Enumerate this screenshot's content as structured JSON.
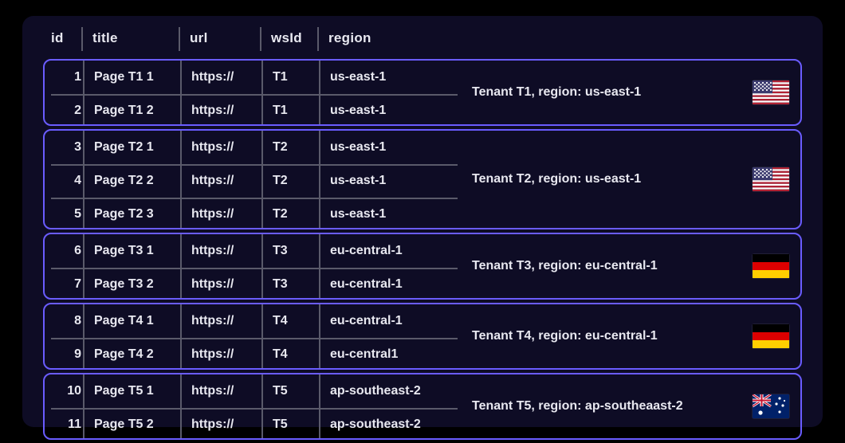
{
  "columns": {
    "id": "id",
    "title": "title",
    "url": "url",
    "wsid": "wsId",
    "region": "region"
  },
  "groups": [
    {
      "summary": "Tenant T1, region: us-east-1",
      "flag": "us",
      "rows": [
        {
          "id": "1",
          "title": "Page T1 1",
          "url": "https://",
          "wsid": "T1",
          "region": "us-east-1"
        },
        {
          "id": "2",
          "title": "Page T1 2",
          "url": "https://",
          "wsid": "T1",
          "region": "us-east-1"
        }
      ]
    },
    {
      "summary": "Tenant T2, region: us-east-1",
      "flag": "us",
      "rows": [
        {
          "id": "3",
          "title": "Page T2 1",
          "url": "https://",
          "wsid": "T2",
          "region": "us-east-1"
        },
        {
          "id": "4",
          "title": "Page T2 2",
          "url": "https://",
          "wsid": "T2",
          "region": "us-east-1"
        },
        {
          "id": "5",
          "title": "Page T2 3",
          "url": "https://",
          "wsid": "T2",
          "region": "us-east-1"
        }
      ]
    },
    {
      "summary": "Tenant T3, region: eu-central-1",
      "flag": "de",
      "rows": [
        {
          "id": "6",
          "title": "Page T3 1",
          "url": "https://",
          "wsid": "T3",
          "region": "eu-central-1"
        },
        {
          "id": "7",
          "title": "Page T3 2",
          "url": "https://",
          "wsid": "T3",
          "region": "eu-central-1"
        }
      ]
    },
    {
      "summary": "Tenant T4, region: eu-central-1",
      "flag": "de",
      "rows": [
        {
          "id": "8",
          "title": "Page T4 1",
          "url": "https://",
          "wsid": "T4",
          "region": "eu-central-1"
        },
        {
          "id": "9",
          "title": "Page T4 2",
          "url": "https://",
          "wsid": "T4",
          "region": "eu-central1"
        }
      ]
    },
    {
      "summary": "Tenant T5, region: ap-southeaast-2",
      "flag": "au",
      "rows": [
        {
          "id": "10",
          "title": "Page T5 1",
          "url": "https://",
          "wsid": "T5",
          "region": "ap-southeast-2"
        },
        {
          "id": "11",
          "title": "Page T5 2",
          "url": "https://",
          "wsid": "T5",
          "region": "ap-southeast-2"
        }
      ]
    }
  ]
}
